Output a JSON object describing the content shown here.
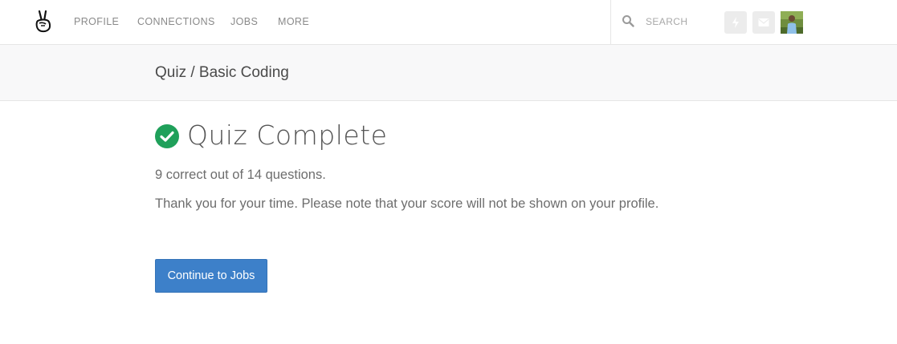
{
  "header": {
    "logo_icon": "victory-hand-logo-icon",
    "nav": [
      {
        "label": "PROFILE"
      },
      {
        "label": "CONNECTIONS"
      },
      {
        "label": "JOBS"
      },
      {
        "label": "MORE"
      }
    ],
    "search": {
      "placeholder": "SEARCH",
      "icon": "search-icon"
    },
    "actions": [
      {
        "icon": "lightning-icon"
      },
      {
        "icon": "mail-icon"
      }
    ],
    "avatar_icon": "user-avatar"
  },
  "subheader": {
    "breadcrumb": "Quiz / Basic Coding"
  },
  "main": {
    "status_icon": "check-circle-icon",
    "title": "Quiz Complete",
    "score": "9 correct out of 14 questions.",
    "note": "Thank you for your time. Please note that your score will not be shown on your profile.",
    "continue_label": "Continue to Jobs"
  },
  "colors": {
    "accent": "#3d80c9",
    "success": "#1fa05a",
    "nav_text": "#8a8a8a",
    "subheader_bg": "#f8f8f9"
  }
}
